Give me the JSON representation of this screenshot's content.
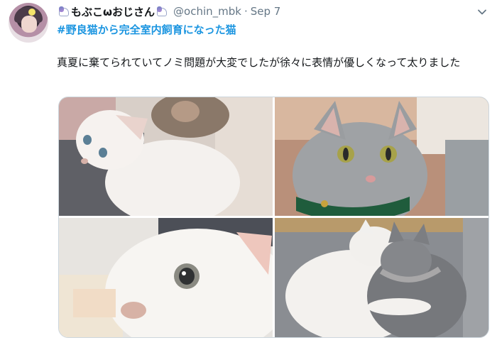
{
  "tweet": {
    "display_name": "もぶこωおじさん",
    "handle": "@ochin_mbk",
    "separator": "·",
    "date": "Sep 7",
    "hashtag": "#野良猫から完全室内飼育になった猫",
    "text": "真夏に棄てられていてノミ問題が大変でしたが徐々に表情が優しくなって太りました"
  },
  "icons": {
    "name_prefix": "unicorn-icon",
    "name_suffix": "unicorn-icon",
    "menu": "chevron-down-icon"
  },
  "colors": {
    "link": "#1b95e0",
    "secondary_text": "#657786",
    "border": "#ccd6dd"
  }
}
